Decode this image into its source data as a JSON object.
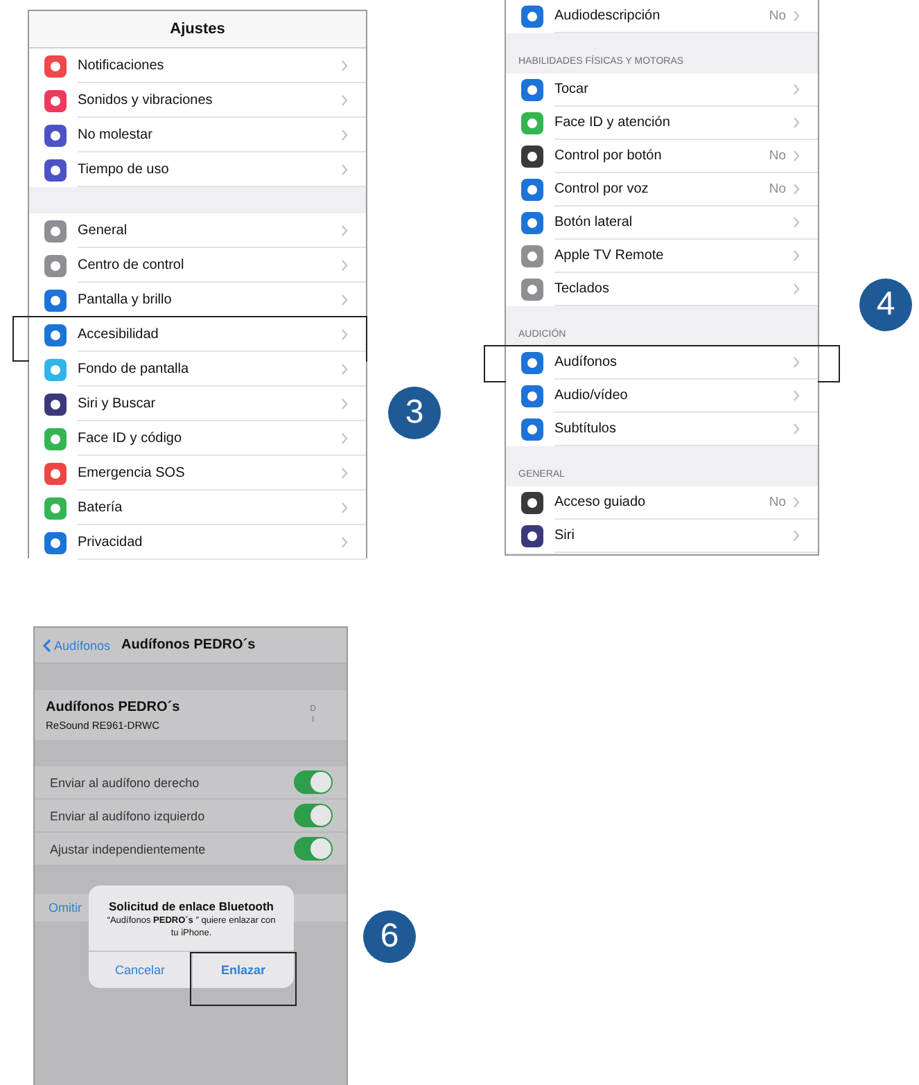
{
  "panels": [
    {
      "kind": "list",
      "step": "3",
      "title": "Ajustes",
      "groups": [
        {
          "items": [
            {
              "label": "Notificaciones",
              "color": "#f0474a"
            },
            {
              "label": "Sonidos y vibraciones",
              "color": "#ef3a5d"
            },
            {
              "label": "No molestar",
              "color": "#4b53c6"
            },
            {
              "label": "Tiempo de uso",
              "color": "#4b53c6"
            }
          ]
        },
        {
          "items": [
            {
              "label": "General",
              "color": "#8e8e93"
            },
            {
              "label": "Centro de control",
              "color": "#8e8e93"
            },
            {
              "label": "Pantalla y brillo",
              "color": "#1d74d8"
            },
            {
              "label": "Accesibilidad",
              "color": "#1d74d8",
              "highlighted": true
            },
            {
              "label": "Fondo de pantalla",
              "color": "#32b4e8"
            },
            {
              "label": "Siri y Buscar",
              "color": "#3a3a7a"
            },
            {
              "label": "Face ID y código",
              "color": "#34b552"
            },
            {
              "label": "Emergencia SOS",
              "color": "#ec4747"
            },
            {
              "label": "Batería",
              "color": "#34b552"
            },
            {
              "label": "Privacidad",
              "color": "#1d74d8"
            }
          ]
        }
      ]
    },
    {
      "kind": "list",
      "step": "4",
      "groups": [
        {
          "items": [
            {
              "label": "Audiodescripción",
              "value": "No",
              "color": "#1d74d8"
            }
          ]
        },
        {
          "header": "HABILIDADES FÍSICAS Y MOTORAS",
          "items": [
            {
              "label": "Tocar",
              "color": "#1d74d8"
            },
            {
              "label": "Face ID y atención",
              "color": "#34b552"
            },
            {
              "label": "Control por botón",
              "value": "No",
              "color": "#3a3a3c"
            },
            {
              "label": "Control por voz",
              "value": "No",
              "color": "#1d74d8"
            },
            {
              "label": "Botón lateral",
              "color": "#1d74d8"
            },
            {
              "label": "Apple TV Remote",
              "color": "#8e8e93"
            },
            {
              "label": "Teclados",
              "color": "#8e8e93"
            }
          ]
        },
        {
          "header": "AUDICIÓN",
          "items": [
            {
              "label": "Audífonos",
              "color": "#1d74d8",
              "highlighted": true
            },
            {
              "label": "Audio/vídeo",
              "color": "#1d74d8"
            },
            {
              "label": "Subtítulos",
              "color": "#1d74d8"
            }
          ]
        },
        {
          "header": "GENERAL",
          "items": [
            {
              "label": "Acceso guiado",
              "value": "No",
              "color": "#3a3a3c"
            },
            {
              "label": "Siri",
              "color": "#3a3a7a"
            }
          ]
        }
      ]
    },
    {
      "kind": "pairing",
      "step": "6",
      "back": "Audífonos",
      "title": "Audífonos PEDRO´s",
      "device": {
        "name": "Audífonos PEDRO´s",
        "model": "ReSound RE961-DRWC",
        "side_marks": [
          "D",
          "I"
        ]
      },
      "toggles": [
        {
          "label": "Enviar al audífono derecho",
          "on": true
        },
        {
          "label": "Enviar al audífono izquierdo",
          "on": true
        },
        {
          "label": "Ajustar independientemente",
          "on": true
        }
      ],
      "skip": "Omitir",
      "alert": {
        "title": "Solicitud de enlace Bluetooth",
        "message": "“Audífonos **PEDRO´s** ” quiere enlazar con tu iPhone.",
        "buttons": [
          {
            "label": "Cancelar"
          },
          {
            "label": "Enlazar",
            "highlighted": true
          }
        ]
      }
    }
  ]
}
